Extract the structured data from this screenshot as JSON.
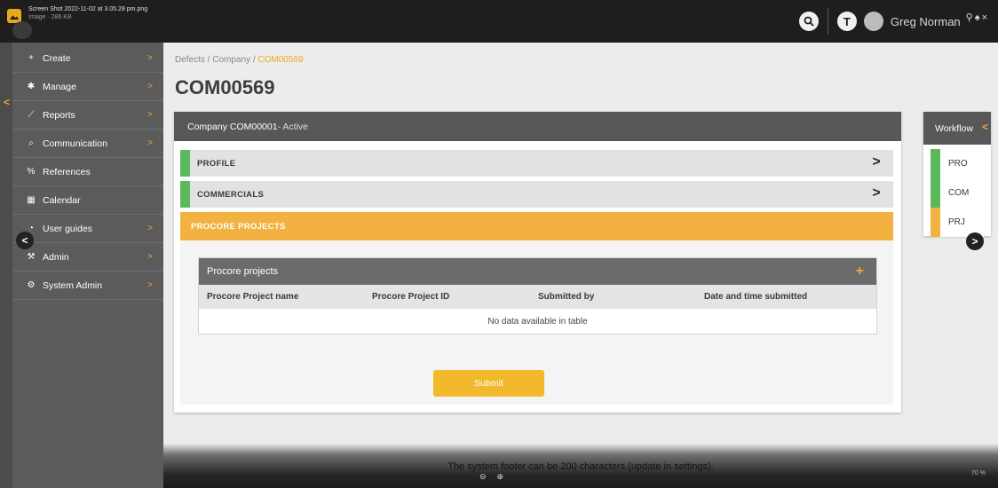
{
  "preview": {
    "filename": "Screen Shot 2022-11-02 at 3.05.28 pm.png",
    "meta": "Image · 286 KB"
  },
  "header": {
    "search_icon": "search-icon",
    "tenant_initial": "T",
    "user_name": "Greg Norman"
  },
  "sidebar": {
    "items": [
      {
        "label": "Create",
        "icon": "+"
      },
      {
        "label": "Manage",
        "icon": "✱"
      },
      {
        "label": "Reports",
        "icon": "⟋"
      },
      {
        "label": "Communication",
        "icon": "⌕"
      },
      {
        "label": "References",
        "icon": "%"
      },
      {
        "label": "Calendar",
        "icon": "▦"
      },
      {
        "label": "User guides",
        "icon": "◔"
      },
      {
        "label": "Admin",
        "icon": "⚒"
      },
      {
        "label": "System Admin",
        "icon": "⚙"
      }
    ]
  },
  "breadcrumb": {
    "part1": "Defects",
    "sep1": " / ",
    "part2": "Company",
    "sep2": " / ",
    "current": "COM00569"
  },
  "page_title": "COM00569",
  "card": {
    "header_name": "Company COM00001",
    "header_status": " - Active",
    "sections": {
      "profile": "PROFILE",
      "commercials": "COMMERCIALS",
      "procore": "PROCORE PROJECTS"
    },
    "table": {
      "title": "Procore projects",
      "columns": [
        "Procore Project name",
        "Procore Project ID",
        "Submitted by",
        "Date and time submitted"
      ],
      "empty_message": "No data available in table"
    },
    "submit_label": "Submit"
  },
  "workflow": {
    "title": "Workflow",
    "steps": [
      "PRO",
      "COM",
      "PRJ"
    ]
  },
  "footer": {
    "text": "The system footer can be 200 characters (update in settings).",
    "zoom": "70 %"
  },
  "colors": {
    "accent": "#f2b140",
    "complete": "#5bb85b",
    "sidebar": "#5b5b5b",
    "topbar": "#1e1e1e"
  }
}
